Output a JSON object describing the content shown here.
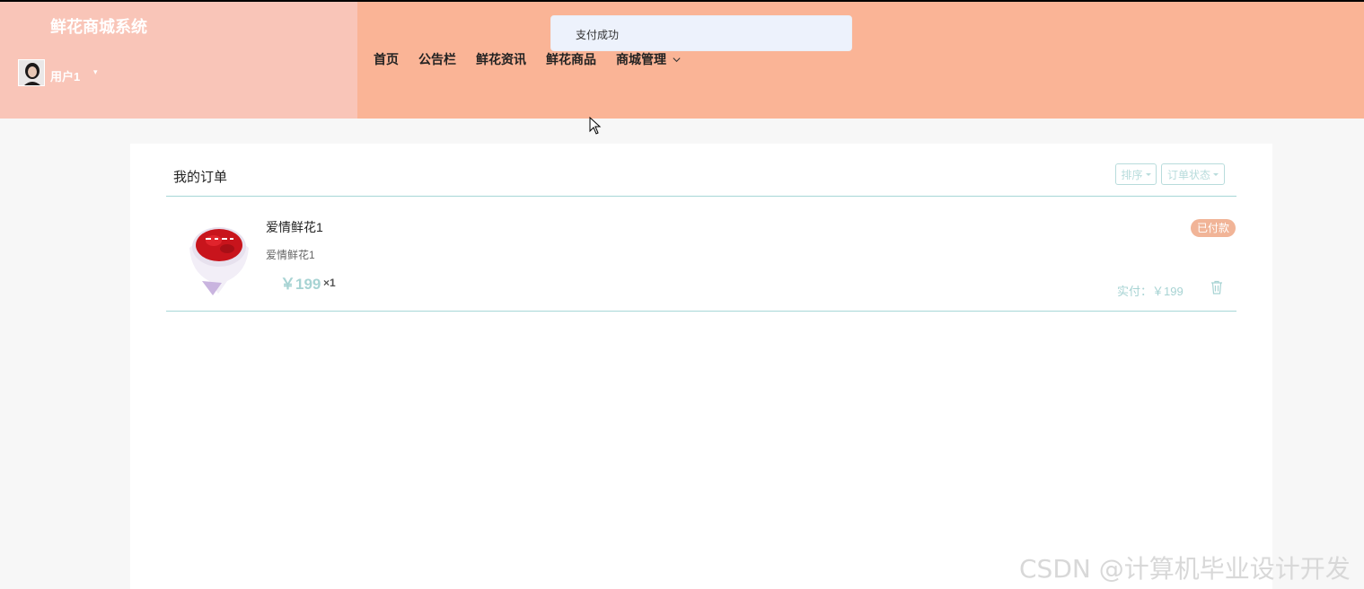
{
  "app": {
    "title": "鲜花商城系统"
  },
  "user": {
    "name": "用户1",
    "caret": "▾"
  },
  "nav": {
    "items": [
      {
        "label": "首页"
      },
      {
        "label": "公告栏"
      },
      {
        "label": "鲜花资讯"
      },
      {
        "label": "鲜花商品"
      },
      {
        "label": "商城管理"
      }
    ]
  },
  "toast": {
    "message": "支付成功"
  },
  "orders": {
    "title": "我的订单",
    "sort_label": "排序",
    "status_label": "订单状态",
    "items": [
      {
        "name": "爱情鲜花1",
        "subtitle": "爱情鲜花1",
        "price": "￥199",
        "qty": "×1",
        "status": "已付款",
        "paid": "实付：￥199"
      }
    ]
  },
  "watermark": "CSDN @计算机毕业设计开发",
  "colors": {
    "header": "#fab496",
    "brand_panel": "#f9c5b8",
    "accent_teal": "#a7d3d3",
    "badge": "#f1b497"
  },
  "icons": {
    "chevron": "chevron-down-icon",
    "trash": "trash-icon",
    "cursor": "mouse-cursor-icon"
  }
}
